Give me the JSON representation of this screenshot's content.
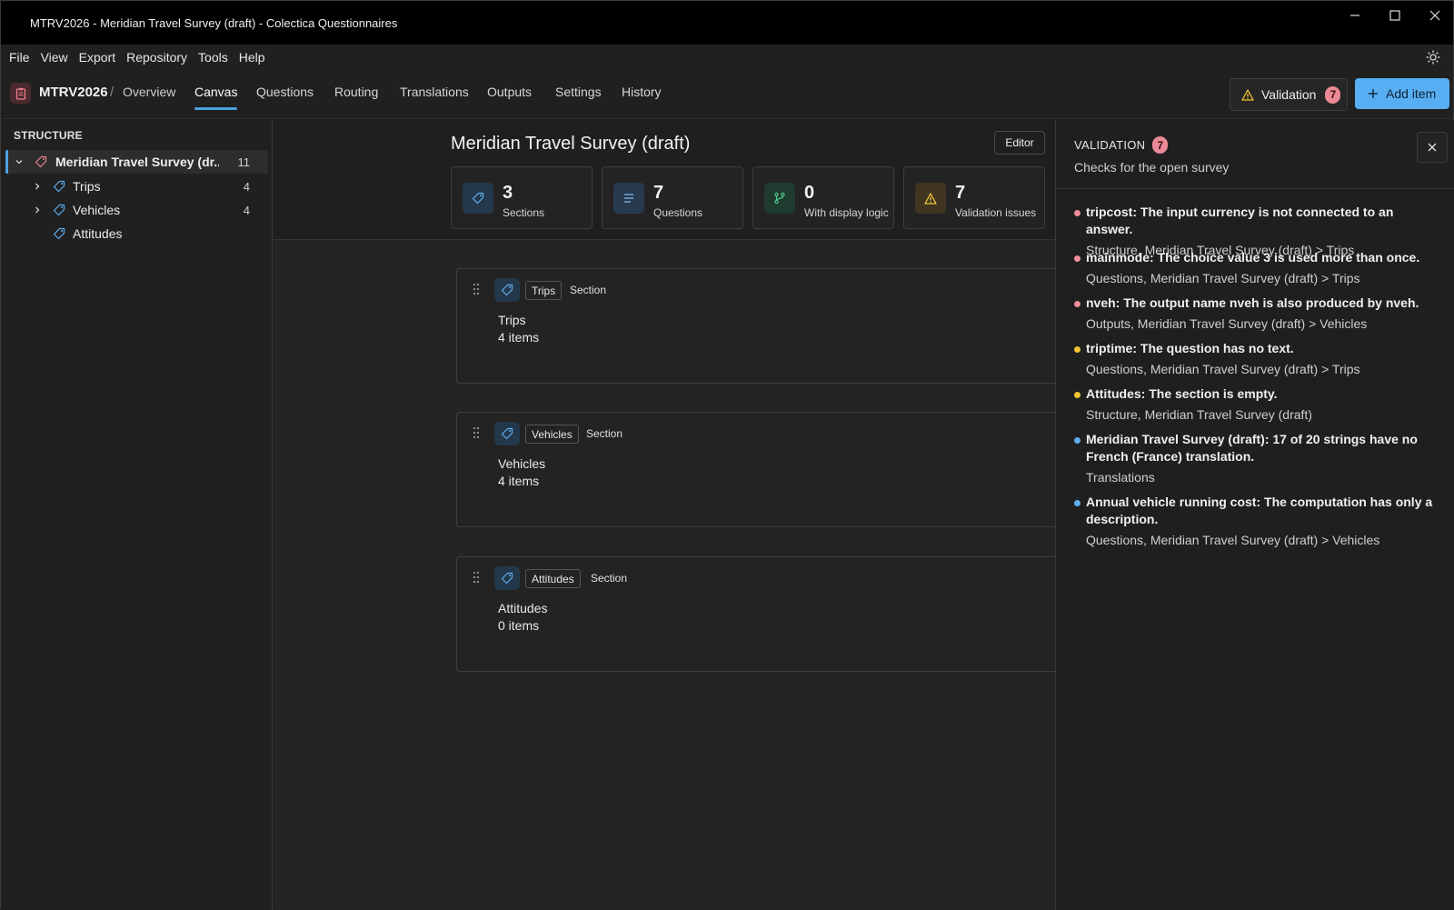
{
  "window": {
    "title": "MTRV2026 - Meridian Travel Survey (draft) - Colectica Questionnaires"
  },
  "menu": [
    "File",
    "View",
    "Export",
    "Repository",
    "Tools",
    "Help"
  ],
  "nav": {
    "id": "MTRV2026",
    "separator": "/",
    "overview": "Overview",
    "tabs": [
      "Canvas",
      "Questions",
      "Routing",
      "Translations",
      "Outputs",
      "Settings",
      "History"
    ],
    "active_tab": "Canvas",
    "validation_label": "Validation",
    "validation_count": "7",
    "add_label": "Add item"
  },
  "sidebar": {
    "heading": "STRUCTURE",
    "root": {
      "label": "Meridian Travel Survey (dr...",
      "count": "11"
    },
    "items": [
      {
        "label": "Trips",
        "count": "4"
      },
      {
        "label": "Vehicles",
        "count": "4"
      },
      {
        "label": "Attitudes",
        "count": ""
      }
    ]
  },
  "main": {
    "title": "Meridian Travel Survey (draft)",
    "editor_label": "Editor",
    "stats": [
      {
        "value": "3",
        "label": "Sections",
        "icon": "tag-icon",
        "color": "#23384a"
      },
      {
        "value": "7",
        "label": "Questions",
        "icon": "lines-icon",
        "color": "#283a4e"
      },
      {
        "value": "0",
        "label": "With display logic",
        "icon": "branch-icon",
        "color": "#1f3a2e"
      },
      {
        "value": "7",
        "label": "Validation issues",
        "icon": "warning-icon",
        "color": "#403521"
      }
    ],
    "sections": [
      {
        "chip": "Trips",
        "type": "Section",
        "name": "Trips",
        "items": "4  items"
      },
      {
        "chip": "Vehicles",
        "type": "Section",
        "name": "Vehicles",
        "items": "4  items"
      },
      {
        "chip": "Attitudes",
        "type": "Section",
        "name": "Attitudes",
        "items": "0  items"
      }
    ]
  },
  "validation": {
    "title": "VALIDATION",
    "count": "7",
    "subtitle": "Checks for the open survey",
    "issues": [
      {
        "severity": "error",
        "color": "#ef8c99",
        "message": "tripcost: The input currency is not connected to an answer.",
        "location": "Structure, Meridian Travel Survey (draft) > Trips"
      },
      {
        "severity": "error",
        "color": "#ef8c99",
        "message": "mainmode: The choice value 3 is used more than once.",
        "location": "Questions, Meridian Travel Survey (draft) > Trips"
      },
      {
        "severity": "error",
        "color": "#ef8c99",
        "message": "nveh: The output name nveh is also produced by nveh.",
        "location": "Outputs, Meridian Travel Survey (draft) > Vehicles"
      },
      {
        "severity": "warning",
        "color": "#f2c530",
        "message": "triptime: The question has no text.",
        "location": "Questions, Meridian Travel Survey (draft) > Trips"
      },
      {
        "severity": "warning",
        "color": "#f2c530",
        "message": "Attitudes: The section is empty.",
        "location": "Structure, Meridian Travel Survey (draft)"
      },
      {
        "severity": "info",
        "color": "#5eaef0",
        "message": "Meridian Travel Survey (draft): 17 of 20 strings have no French (France) translation.",
        "location": "Translations"
      },
      {
        "severity": "info",
        "color": "#5eaef0",
        "message": "Annual vehicle running cost: The computation has only a description.",
        "location": "Questions, Meridian Travel Survey (draft) > Vehicles"
      }
    ]
  }
}
